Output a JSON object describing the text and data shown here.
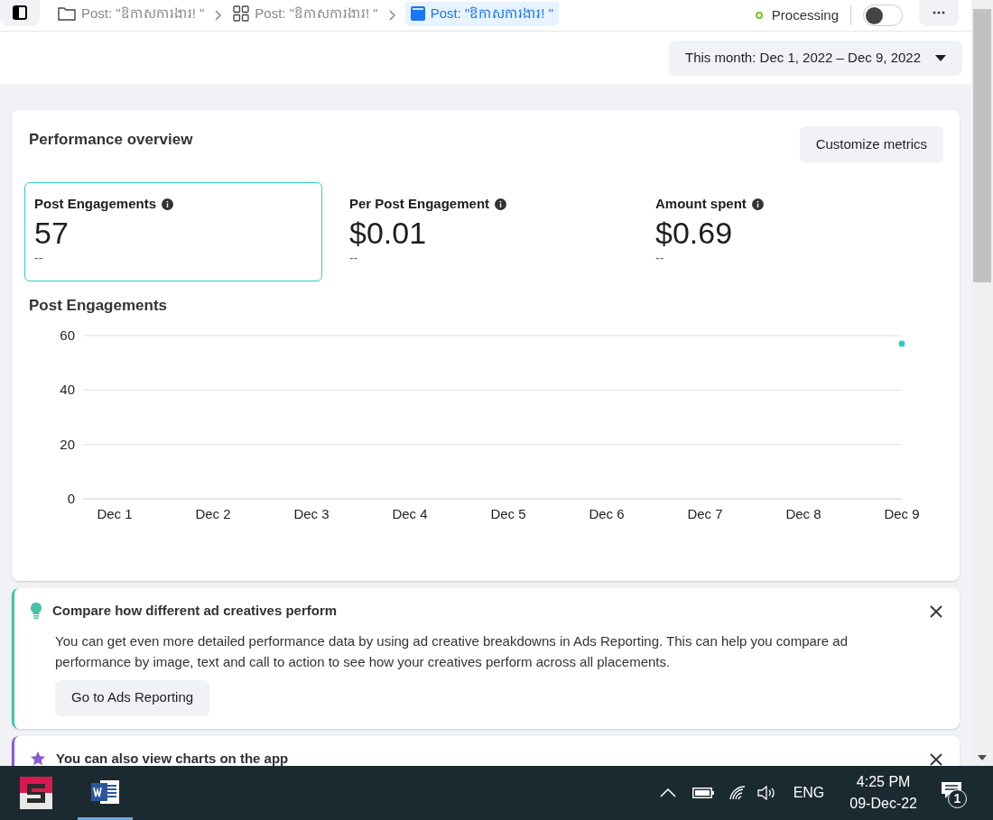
{
  "breadcrumbs": [
    {
      "label": "Post: \"ឱកាសការងារ! \"",
      "kind": "folder",
      "selected": false
    },
    {
      "label": "Post: \"ឱកាសការងារ! \"",
      "kind": "grid",
      "selected": false
    },
    {
      "label": "Post: \"ឱកាសការងារ! \"",
      "kind": "post",
      "selected": true
    }
  ],
  "status": {
    "label": "Processing",
    "color": "#7cc121"
  },
  "toggle": {
    "on": false
  },
  "date_range": {
    "label": "This month: Dec 1, 2022 – Dec 9, 2022"
  },
  "performance": {
    "title": "Performance overview",
    "customize_button": "Customize metrics",
    "metrics": [
      {
        "label": "Post Engagements",
        "value": "57",
        "change": "--",
        "selected": true
      },
      {
        "label": "Per Post Engagement",
        "value": "$0.01",
        "change": "--",
        "selected": false
      },
      {
        "label": "Amount spent",
        "value": "$0.69",
        "change": "--",
        "selected": false
      }
    ],
    "chart_data": {
      "type": "line",
      "title": "Post Engagements",
      "categories": [
        "Dec 1",
        "Dec 2",
        "Dec 3",
        "Dec 4",
        "Dec 5",
        "Dec 6",
        "Dec 7",
        "Dec 8",
        "Dec 9"
      ],
      "series": [
        {
          "color": "#2ec9c9",
          "marker": true,
          "values": [
            null,
            null,
            null,
            null,
            null,
            null,
            null,
            null,
            57
          ]
        }
      ],
      "ylim": [
        0,
        60
      ],
      "yticks": [
        0,
        20,
        40,
        60
      ]
    }
  },
  "tips": [
    {
      "kind": "bulb",
      "color": "#47c1a8",
      "title": "Compare how different ad creatives perform",
      "body": "You can get even more detailed performance data by using ad creative breakdowns in Ads Reporting. This can help you compare ad performance by image, text and call to action to see how your creatives perform across all placements.",
      "button": "Go to Ads Reporting"
    },
    {
      "kind": "star",
      "color": "#8a5bd6",
      "title": "You can also view charts on the app"
    }
  ],
  "taskbar": {
    "language": "ENG",
    "time": "4:25 PM",
    "date": "09-Dec-22",
    "notifications": "1"
  }
}
